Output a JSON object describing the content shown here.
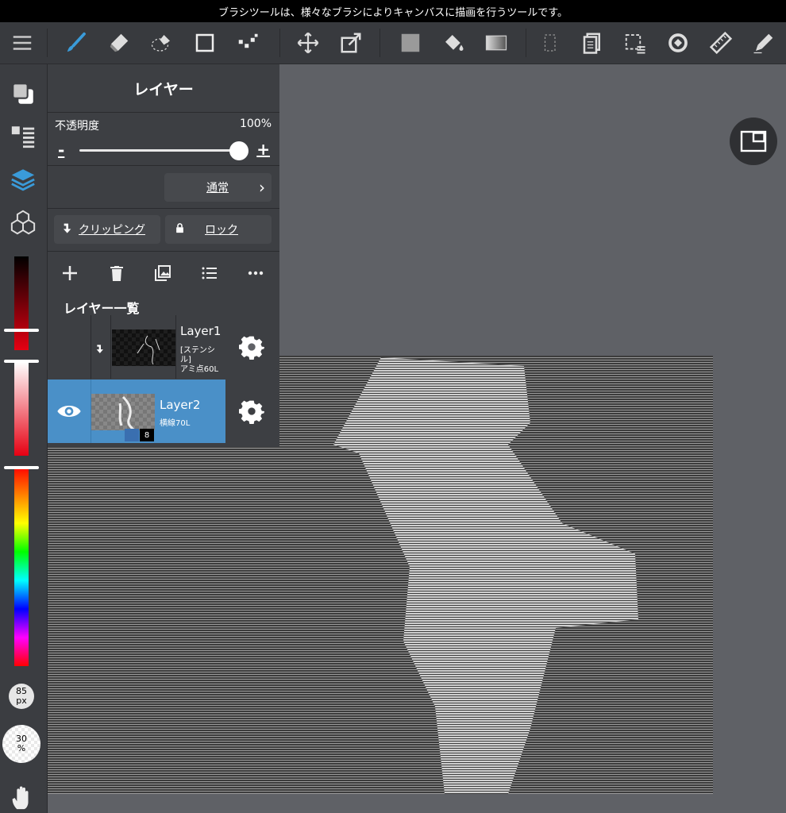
{
  "help_text": "ブラシツールは、様々なブラシによりキャンバスに描画を行うツールです。",
  "toolbar": {
    "icons": [
      "menu-icon",
      "brush-icon",
      "eraser-icon",
      "lasso-eraser-icon",
      "rectangle-icon",
      "dot-icon",
      "move-icon",
      "transform-icon",
      "fill-color-icon",
      "bucket-icon",
      "gradient-icon",
      "select-dotted-icon",
      "copy-layer-icon",
      "selection-menu-icon",
      "rotate-icon",
      "ruler-icon",
      "snap-pen-icon"
    ]
  },
  "sidebar": {
    "brush_size": "85",
    "brush_size_unit": "px",
    "brush_opacity": "30",
    "brush_opacity_unit": "%"
  },
  "panel": {
    "title": "レイヤー",
    "opacity_label": "不透明度",
    "opacity_value": "100%",
    "opacity_fraction": 1.0,
    "minus": "-",
    "plus": "+",
    "blend_mode": "通常",
    "clipping_label": "クリッピング",
    "lock_label": "ロック",
    "list_label": "レイヤー一覧"
  },
  "layers": [
    {
      "name": "Layer1",
      "detail_1": "[ステンシ",
      "detail_2": "ル]",
      "detail_3": "アミ点60L"
    },
    {
      "name": "Layer2",
      "detail_1": "横線70L",
      "badge": "8"
    }
  ],
  "colors": {
    "accent": "#3a9bd9",
    "selected_layer": "#4a90c8",
    "panel_bg": "#3d3f43",
    "toolbar_bg": "#383a3e"
  }
}
